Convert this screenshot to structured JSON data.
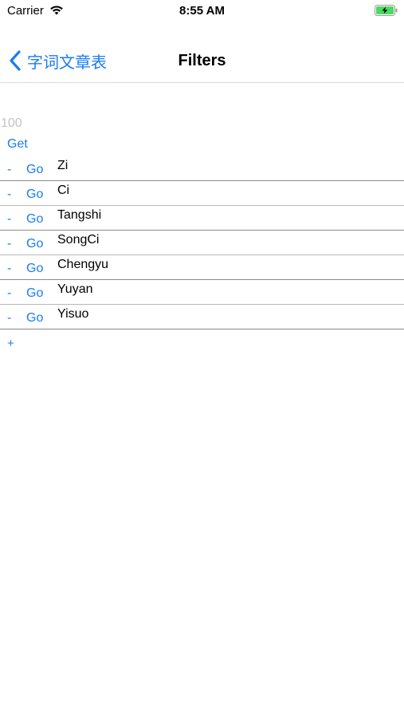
{
  "status_bar": {
    "carrier": "Carrier",
    "time": "8:55 AM",
    "icons": [
      "wifi-icon",
      "battery-charging-icon"
    ]
  },
  "nav": {
    "back_label": "字词文章表",
    "title": "Filters",
    "back_icon": "chevron-left-icon"
  },
  "count_field": {
    "placeholder": "100"
  },
  "get_label": "Get",
  "rows": [
    {
      "remove": "-",
      "go": "Go",
      "name": "Zi"
    },
    {
      "remove": "-",
      "go": "Go",
      "name": "Ci"
    },
    {
      "remove": "-",
      "go": "Go",
      "name": "Tangshi"
    },
    {
      "remove": "-",
      "go": "Go",
      "name": "SongCi"
    },
    {
      "remove": "-",
      "go": "Go",
      "name": "Chengyu"
    },
    {
      "remove": "-",
      "go": "Go",
      "name": "Yuyan"
    },
    {
      "remove": "-",
      "go": "Go",
      "name": "Yisuo"
    }
  ],
  "add_label": "+",
  "colors": {
    "accent": "#1a7cf3",
    "placeholder": "#c4c4c4",
    "battery": "#4cd964"
  }
}
